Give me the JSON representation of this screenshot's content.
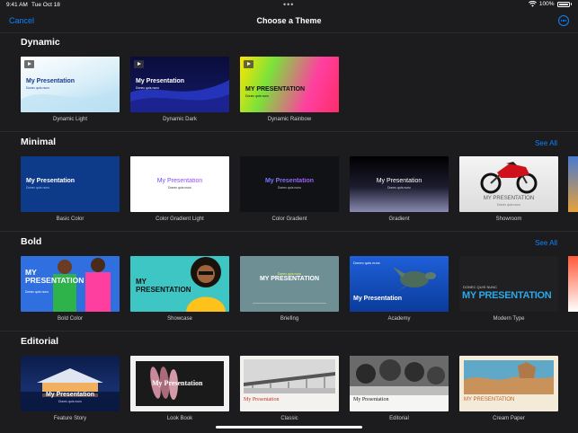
{
  "status": {
    "time": "9:41 AM",
    "date": "Tue Oct 18",
    "battery": "100%"
  },
  "nav": {
    "cancel": "Cancel",
    "title": "Choose a Theme"
  },
  "see_all": "See All",
  "sections": {
    "dynamic": {
      "title": "Dynamic",
      "themes": [
        {
          "label": "Dynamic Light",
          "title": "My Presentation",
          "subtitle": "Donec quis nunc"
        },
        {
          "label": "Dynamic Dark",
          "title": "My Presentation",
          "subtitle": "Donec quis nunc"
        },
        {
          "label": "Dynamic Rainbow",
          "title": "MY PRESENTATION",
          "subtitle": "Donec quis nunc"
        }
      ]
    },
    "minimal": {
      "title": "Minimal",
      "themes": [
        {
          "label": "Basic Color",
          "title": "My Presentation",
          "subtitle": "Donec quis nunc"
        },
        {
          "label": "Color Gradient Light",
          "title": "My Presentation",
          "subtitle": "Donec quis nunc"
        },
        {
          "label": "Color Gradient",
          "title": "My Presentation",
          "subtitle": "Donec quis nunc"
        },
        {
          "label": "Gradient",
          "title": "My Presentation",
          "subtitle": "Donec quis nunc"
        },
        {
          "label": "Showroom",
          "title": "MY PRESENTATION",
          "subtitle": "Donec quis nunc"
        }
      ]
    },
    "bold": {
      "title": "Bold",
      "themes": [
        {
          "label": "Bold Color",
          "title": "MY PRESENTATION",
          "subtitle": "Donec quis nunc"
        },
        {
          "label": "Showcase",
          "title": "MY PRESENTATION",
          "subtitle": ""
        },
        {
          "label": "Briefing",
          "title": "MY PRESENTATION",
          "subtitle": "Donec quis nunc"
        },
        {
          "label": "Academy",
          "title": "My Presentation",
          "subtitle": "Donec quis nunc"
        },
        {
          "label": "Modern Type",
          "title": "MY PRESENTATION",
          "subtitle": "DONEC QUIS NUNC"
        }
      ]
    },
    "editorial": {
      "title": "Editorial",
      "themes": [
        {
          "label": "Feature Story",
          "title": "My Presentation",
          "subtitle": "Donec quis nunc"
        },
        {
          "label": "Look Book",
          "title": "My Presentation",
          "subtitle": ""
        },
        {
          "label": "Classic",
          "title": "My Presentation",
          "subtitle": ""
        },
        {
          "label": "Editorial",
          "title": "My Presentation",
          "subtitle": ""
        },
        {
          "label": "Cream Paper",
          "title": "MY PRESENTATION",
          "subtitle": ""
        }
      ]
    }
  },
  "colors": {
    "accent": "#0a84ff",
    "background": "#1c1c1e"
  }
}
